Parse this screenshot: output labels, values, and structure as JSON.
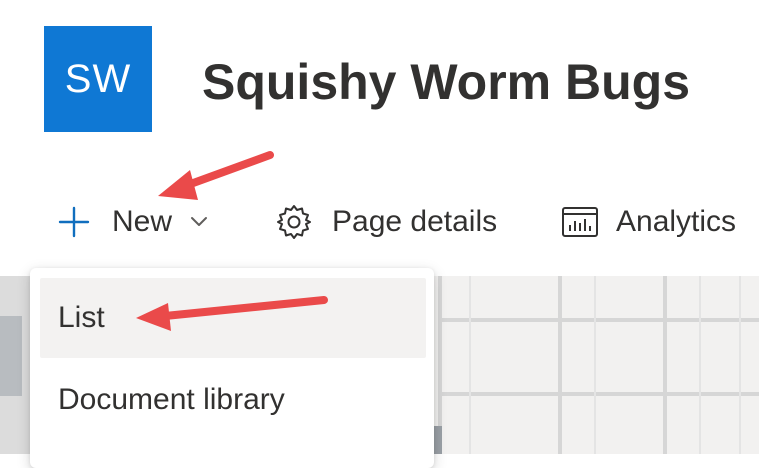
{
  "site": {
    "logo_initials": "SW",
    "title": "Squishy Worm Bugs",
    "brand_color": "#0f78d4"
  },
  "command_bar": {
    "new": {
      "label": "New",
      "icon": "plus-icon",
      "caret_icon": "chevron-down-icon",
      "icon_color": "#106ebe"
    },
    "page_details": {
      "label": "Page details",
      "icon": "gear-icon"
    },
    "analytics": {
      "label": "Analytics",
      "icon": "analytics-chart-icon"
    }
  },
  "new_menu": {
    "items": [
      {
        "label": "List",
        "highlighted": true
      },
      {
        "label": "Document library",
        "highlighted": false
      }
    ]
  },
  "annotations": {
    "arrow_color": "#ea4a4a",
    "arrows": [
      "points-to-new-button",
      "points-to-list-item"
    ]
  }
}
